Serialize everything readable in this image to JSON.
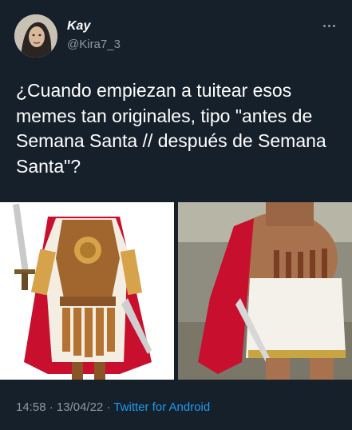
{
  "author": {
    "name": "Kay",
    "handle": "@Kira7_3"
  },
  "tweet": {
    "text": "¿Cuando empiezan a tuitear esos memes tan originales, tipo \"antes de Semana Santa // después de Semana Santa\"?",
    "time": "14:58",
    "separator": " · ",
    "date": "13/04/22",
    "source": "Twitter for Android"
  },
  "icons": {
    "more": "more-horizontal-icon"
  },
  "colors": {
    "background": "#15202b",
    "secondary_text": "#8b98a5",
    "link": "#1d9bf0"
  }
}
